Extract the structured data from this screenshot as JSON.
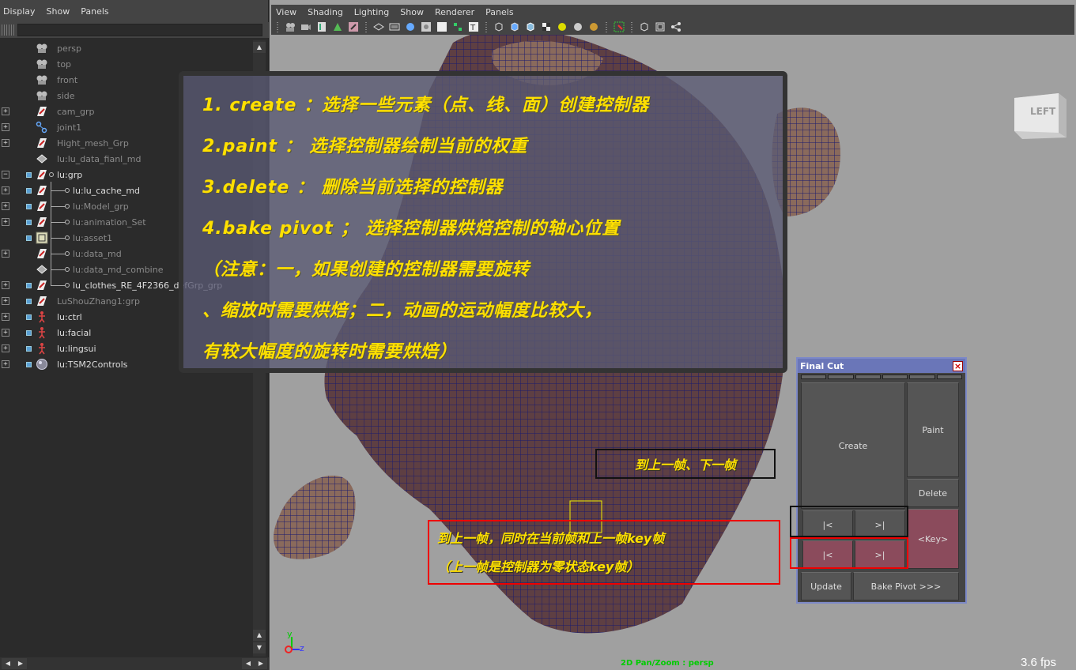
{
  "outliner": {
    "menu": [
      "Display",
      "Show",
      "Panels"
    ],
    "filter_value": "",
    "items": [
      {
        "label": "persp",
        "icon": "camera-icon",
        "dim": true,
        "expand": "",
        "lock": false,
        "indent": 72
      },
      {
        "label": "top",
        "icon": "camera-icon",
        "dim": true,
        "expand": "",
        "lock": false,
        "indent": 72
      },
      {
        "label": "front",
        "icon": "camera-icon",
        "dim": true,
        "expand": "",
        "lock": false,
        "indent": 72
      },
      {
        "label": "side",
        "icon": "camera-icon",
        "dim": true,
        "expand": "",
        "lock": false,
        "indent": 72
      },
      {
        "label": "cam_grp",
        "icon": "group-icon",
        "dim": true,
        "expand": "+",
        "lock": false,
        "indent": 72
      },
      {
        "label": "joint1",
        "icon": "joint-icon",
        "dim": true,
        "expand": "+",
        "lock": false,
        "indent": 72
      },
      {
        "label": "Hight_mesh_Grp",
        "icon": "group-icon",
        "dim": true,
        "expand": "+",
        "lock": false,
        "indent": 72
      },
      {
        "label": "lu:lu_data_fianl_md",
        "icon": "mesh-icon",
        "dim": true,
        "expand": "",
        "lock": false,
        "indent": 72
      },
      {
        "label": "lu:grp",
        "icon": "group-icon",
        "dim": false,
        "expand": "−",
        "lock": true,
        "indent": 72
      },
      {
        "label": "lu:lu_cache_md",
        "icon": "group-icon",
        "dim": false,
        "expand": "+",
        "lock": true,
        "indent": 92
      },
      {
        "label": "lu:Model_grp",
        "icon": "group-icon",
        "dim": true,
        "expand": "+",
        "lock": true,
        "indent": 92
      },
      {
        "label": "lu:animation_Set",
        "icon": "group-icon",
        "dim": true,
        "expand": "+",
        "lock": true,
        "indent": 92
      },
      {
        "label": "lu:asset1",
        "icon": "asset-icon",
        "dim": true,
        "expand": "",
        "lock": true,
        "indent": 92
      },
      {
        "label": "lu:data_md",
        "icon": "group-icon",
        "dim": true,
        "expand": "+",
        "lock": false,
        "indent": 92
      },
      {
        "label": "lu:data_md_combine",
        "icon": "mesh-icon",
        "dim": true,
        "expand": "",
        "lock": false,
        "indent": 92
      },
      {
        "label": "lu_clothes_RE_4F2366_defGrp_grp",
        "icon": "group-icon",
        "dim": false,
        "expand": "+",
        "lock": true,
        "indent": 92
      },
      {
        "label": "LuShouZhang1:grp",
        "icon": "group-icon",
        "dim": true,
        "expand": "+",
        "lock": true,
        "indent": 72
      },
      {
        "label": "lu:ctrl",
        "icon": "figure-icon",
        "dim": false,
        "expand": "+",
        "lock": true,
        "indent": 72
      },
      {
        "label": "lu:facial",
        "icon": "figure-icon",
        "dim": false,
        "expand": "+",
        "lock": true,
        "indent": 72
      },
      {
        "label": "lu:lingsui",
        "icon": "figure-icon",
        "dim": false,
        "expand": "+",
        "lock": true,
        "indent": 72
      },
      {
        "label": "lu:TSM2Controls",
        "icon": "sphere-icon",
        "dim": false,
        "expand": "+",
        "lock": true,
        "indent": 72
      }
    ]
  },
  "viewport": {
    "menu": [
      "View",
      "Shading",
      "Lighting",
      "Show",
      "Renderer",
      "Panels"
    ],
    "view_cube_label": "LEFT",
    "fps": "3.6 fps",
    "status": "2D Pan/Zoom : persp",
    "axis": {
      "y": "y",
      "z": "z"
    }
  },
  "annotation": {
    "lines": [
      "1. create ：选择一些元素（点、线、面）创建控制器",
      "2.paint ： 选择控制器绘制当前的权重",
      "3.delete ： 删除当前选择的控制器",
      "4.bake pivot ； 选择控制器烘焙控制的轴心位置",
      "（注意：一，如果创建的控制器需要旋转",
      "、缩放时需要烘焙；二，动画的运动幅度比较大，",
      "有较大幅度的旋转时需要烘焙）"
    ]
  },
  "callouts": {
    "black": "到上一帧、下一帧",
    "red_line1": "到上一帧，同时在当前帧和上一帧key帧",
    "red_line2": "（上一帧是控制器为零状态key帧）"
  },
  "finalcut": {
    "title": "Final Cut",
    "close": "×",
    "create": "Create",
    "paint": "Paint",
    "delete": "Delete",
    "prev": "|<",
    "next": ">|",
    "prev_key": "|<",
    "next_key": ">|",
    "key": "<Key>",
    "update": "Update",
    "bake": "Bake Pivot >>>"
  },
  "colors": {
    "annotation_text": "#ffe000",
    "key_button": "#8b4b5c",
    "finalcut_title": "#6a76b8",
    "callout_red": "#e00000"
  }
}
